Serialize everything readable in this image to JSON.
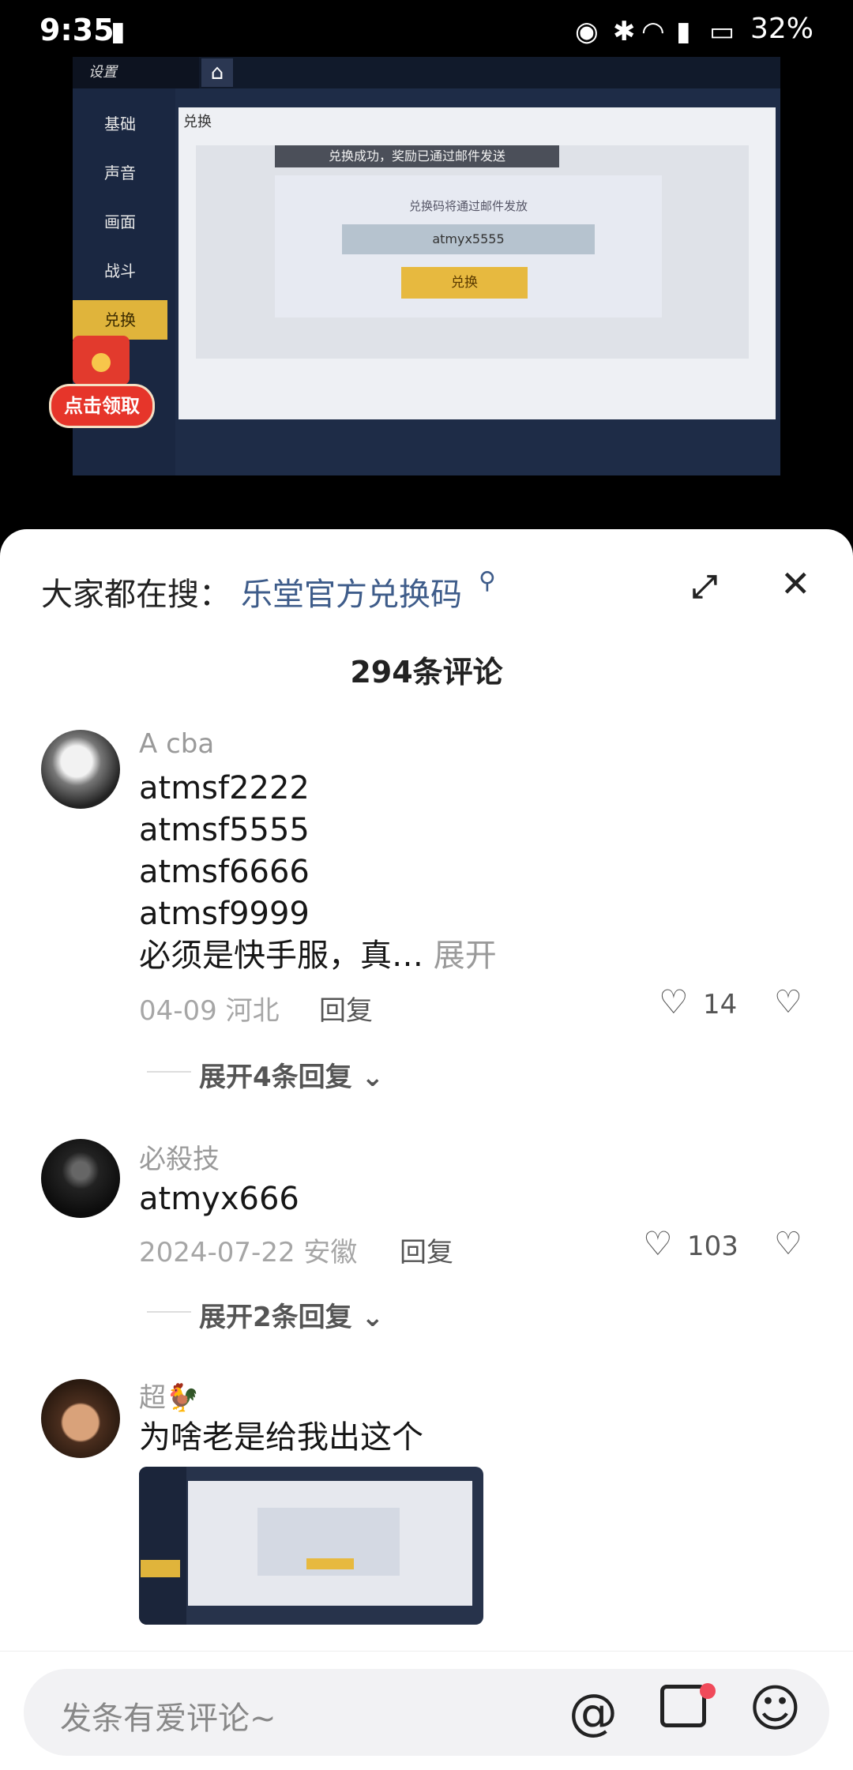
{
  "status_bar": {
    "time": "9:35",
    "battery": "32%",
    "icons": [
      "sim-alert-icon",
      "eye-icon",
      "bluetooth-icon",
      "wifi-icon",
      "alert-icon",
      "battery-icon"
    ]
  },
  "video": {
    "logo_text": "设置",
    "side_menu": [
      "基础",
      "声音",
      "画面",
      "战斗",
      "兑换"
    ],
    "panel_title": "兑换",
    "banner": "兑换成功，奖励已通过邮件发送",
    "hint": "兑换码将通过邮件发放",
    "code_value": "atmyx5555",
    "redeem_button": "兑换",
    "claim_button": "点击领取"
  },
  "sheet": {
    "search_prefix": "大家都在搜：",
    "search_term": "乐堂官方兑换码",
    "comment_count": "294条评论"
  },
  "comments": [
    {
      "username": "A cba",
      "lines": [
        "atmsf2222",
        "atmsf5555",
        "atmsf6666",
        "atmsf9999"
      ],
      "last_line": "必须是快手服，真…",
      "more": "展开",
      "date_location": "04-09 河北",
      "reply": "回复",
      "likes": "14",
      "expand_replies": "展开4条回复"
    },
    {
      "username": "必殺技",
      "text": "atmyx666",
      "date_location": "2024-07-22 安徽",
      "reply": "回复",
      "likes": "103",
      "expand_replies": "展开2条回复"
    },
    {
      "username": "超🐓",
      "text": "为啥老是给我出这个"
    }
  ],
  "input": {
    "placeholder": "发条有爱评论~"
  }
}
